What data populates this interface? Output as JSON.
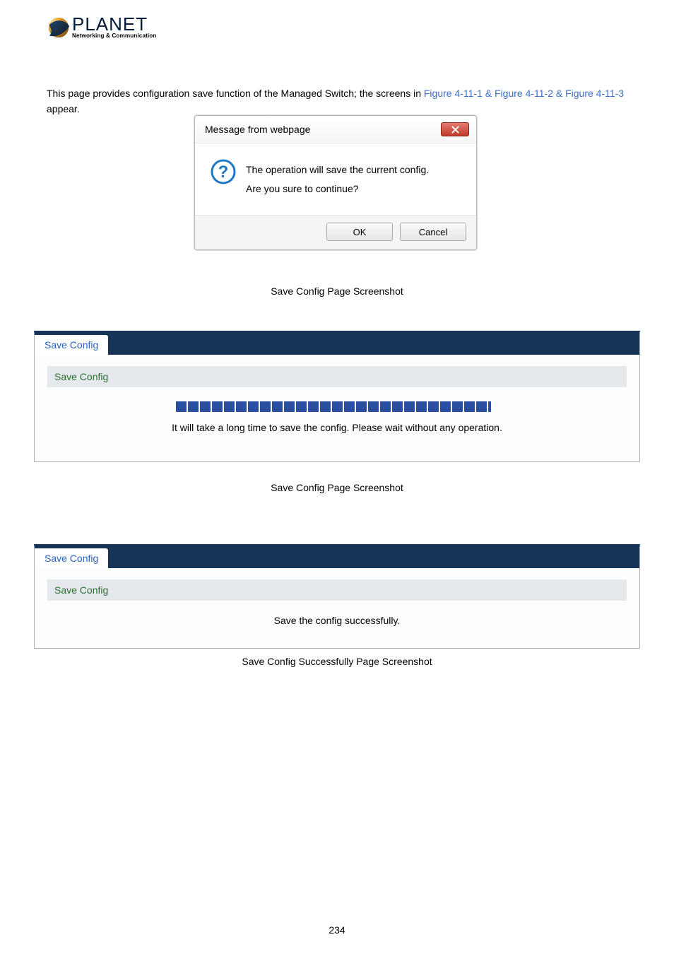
{
  "logo": {
    "name": "PLANET",
    "sub": "Networking & Communication"
  },
  "intro": {
    "pre": "This page provides configuration save function of the Managed Switch; the screens in ",
    "figs": "Figure 4-11-1 & Figure 4-11-2 & Figure 4-11-3",
    "post": " appear."
  },
  "dialog1": {
    "title": "Message from webpage",
    "line1": "The operation will save the current config.",
    "line2": "Are you sure to continue?",
    "ok": "OK",
    "cancel": "Cancel"
  },
  "caption1": "Save Config Page Screenshot",
  "panel1": {
    "tab": "Save Config",
    "sub": "Save Config",
    "msg": "It will take a long time to save the config. Please wait without any operation."
  },
  "caption2": "Save Config Page Screenshot",
  "panel2": {
    "tab": "Save Config",
    "sub": "Save Config",
    "msg": "Save the config successfully."
  },
  "caption3": "Save Config Successfully Page Screenshot",
  "pagenum": "234"
}
